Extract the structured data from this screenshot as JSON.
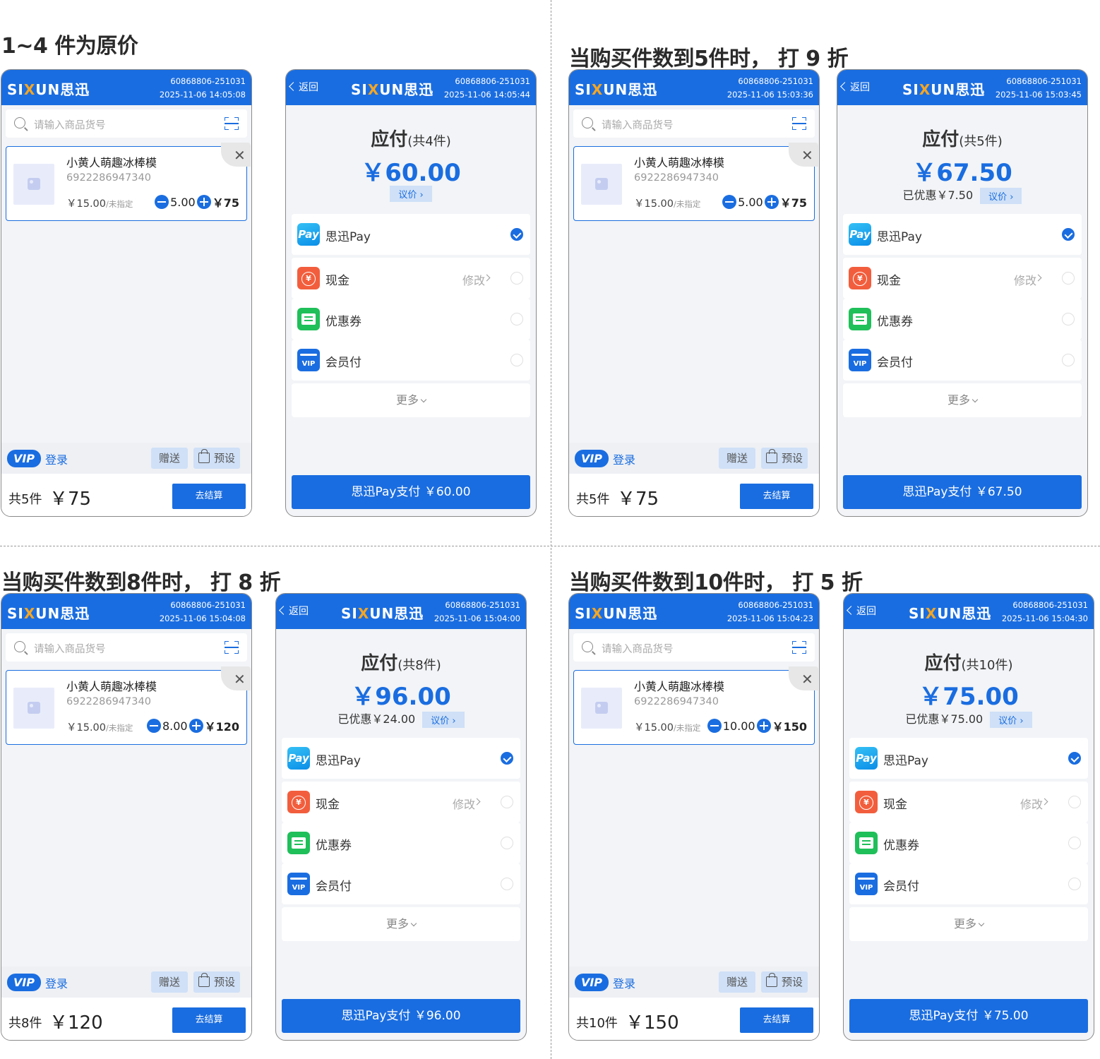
{
  "titles": {
    "s1": "1~4 件为原价",
    "s2": "当购买件数到5件时， 打 9 折",
    "s3": "当购买件数到8件时， 打 8 折",
    "s4": "当购买件数到10件时， 打 5 折"
  },
  "common": {
    "logo_left": "SI",
    "logo_x": "X",
    "logo_right": "UN思迅",
    "back": "返回",
    "search_placeholder": "请输入商品货号",
    "item_name": "小黄人萌趣冰棒模",
    "item_code": "6922286947340",
    "item_price": "￥15.00",
    "item_unit": "/未指定",
    "close": "✕",
    "vip": "VIP",
    "login": "登录",
    "gift": "赠送",
    "preset": "预设",
    "checkout": "去结算",
    "yijia": "议价 ›",
    "pay_sixun": "思迅Pay",
    "pay_cash": "现金",
    "pay_coupon": "优惠券",
    "pay_member": "会员付",
    "modify": "修改",
    "more": "更多",
    "pay_icon": "Pay",
    "cash_icon": "¥",
    "vip_icon": "VIP"
  },
  "screens": {
    "s1": {
      "cart": {
        "code": "60868806-251031",
        "time": "2025-11-06 14:05:08",
        "qty": "5.00",
        "subtotal": "￥75",
        "count": "共5件",
        "total": "￥75"
      },
      "pay": {
        "code": "60868806-251031",
        "time": "2025-11-06 14:05:44",
        "head": "应付",
        "head_sub": "(共4件)",
        "amount": "￥60.00",
        "discount": "",
        "btn": "思迅Pay支付 ￥60.00"
      }
    },
    "s2": {
      "cart": {
        "code": "60868806-251031",
        "time": "2025-11-06 15:03:36",
        "qty": "5.00",
        "subtotal": "￥75",
        "count": "共5件",
        "total": "￥75"
      },
      "pay": {
        "code": "60868806-251031",
        "time": "2025-11-06 15:03:45",
        "head": "应付",
        "head_sub": "(共5件)",
        "amount": "￥67.50",
        "discount": "已优惠￥7.50",
        "btn": "思迅Pay支付 ￥67.50"
      }
    },
    "s3": {
      "cart": {
        "code": "60868806-251031",
        "time": "2025-11-06 15:04:08",
        "qty": "8.00",
        "subtotal": "￥120",
        "count": "共8件",
        "total": "￥120"
      },
      "pay": {
        "code": "60868806-251031",
        "time": "2025-11-06 15:04:00",
        "head": "应付",
        "head_sub": "(共8件)",
        "amount": "￥96.00",
        "discount": "已优惠￥24.00",
        "btn": "思迅Pay支付 ￥96.00"
      }
    },
    "s4": {
      "cart": {
        "code": "60868806-251031",
        "time": "2025-11-06 15:04:23",
        "qty": "10.00",
        "subtotal": "￥150",
        "count": "共10件",
        "total": "￥150"
      },
      "pay": {
        "code": "60868806-251031",
        "time": "2025-11-06 15:04:30",
        "head": "应付",
        "head_sub": "(共10件)",
        "amount": "￥75.00",
        "discount": "已优惠￥75.00",
        "btn": "思迅Pay支付 ￥75.00"
      }
    }
  },
  "colors": {
    "brand": "#1a6de0",
    "logo_x": "#f5a623",
    "cash": "#f25e3d",
    "coupon": "#1fbf5a"
  }
}
